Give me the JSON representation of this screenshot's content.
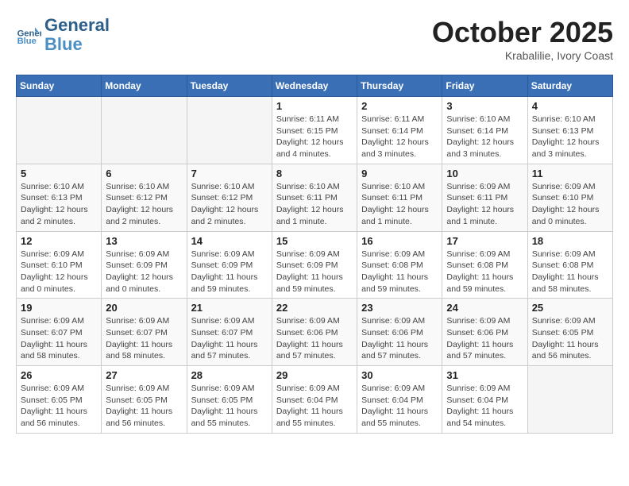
{
  "header": {
    "logo_line1": "General",
    "logo_line2": "Blue",
    "month": "October 2025",
    "location": "Krabalilie, Ivory Coast"
  },
  "weekdays": [
    "Sunday",
    "Monday",
    "Tuesday",
    "Wednesday",
    "Thursday",
    "Friday",
    "Saturday"
  ],
  "weeks": [
    [
      {
        "day": "",
        "info": ""
      },
      {
        "day": "",
        "info": ""
      },
      {
        "day": "",
        "info": ""
      },
      {
        "day": "1",
        "info": "Sunrise: 6:11 AM\nSunset: 6:15 PM\nDaylight: 12 hours\nand 4 minutes."
      },
      {
        "day": "2",
        "info": "Sunrise: 6:11 AM\nSunset: 6:14 PM\nDaylight: 12 hours\nand 3 minutes."
      },
      {
        "day": "3",
        "info": "Sunrise: 6:10 AM\nSunset: 6:14 PM\nDaylight: 12 hours\nand 3 minutes."
      },
      {
        "day": "4",
        "info": "Sunrise: 6:10 AM\nSunset: 6:13 PM\nDaylight: 12 hours\nand 3 minutes."
      }
    ],
    [
      {
        "day": "5",
        "info": "Sunrise: 6:10 AM\nSunset: 6:13 PM\nDaylight: 12 hours\nand 2 minutes."
      },
      {
        "day": "6",
        "info": "Sunrise: 6:10 AM\nSunset: 6:12 PM\nDaylight: 12 hours\nand 2 minutes."
      },
      {
        "day": "7",
        "info": "Sunrise: 6:10 AM\nSunset: 6:12 PM\nDaylight: 12 hours\nand 2 minutes."
      },
      {
        "day": "8",
        "info": "Sunrise: 6:10 AM\nSunset: 6:11 PM\nDaylight: 12 hours\nand 1 minute."
      },
      {
        "day": "9",
        "info": "Sunrise: 6:10 AM\nSunset: 6:11 PM\nDaylight: 12 hours\nand 1 minute."
      },
      {
        "day": "10",
        "info": "Sunrise: 6:09 AM\nSunset: 6:11 PM\nDaylight: 12 hours\nand 1 minute."
      },
      {
        "day": "11",
        "info": "Sunrise: 6:09 AM\nSunset: 6:10 PM\nDaylight: 12 hours\nand 0 minutes."
      }
    ],
    [
      {
        "day": "12",
        "info": "Sunrise: 6:09 AM\nSunset: 6:10 PM\nDaylight: 12 hours\nand 0 minutes."
      },
      {
        "day": "13",
        "info": "Sunrise: 6:09 AM\nSunset: 6:09 PM\nDaylight: 12 hours\nand 0 minutes."
      },
      {
        "day": "14",
        "info": "Sunrise: 6:09 AM\nSunset: 6:09 PM\nDaylight: 11 hours\nand 59 minutes."
      },
      {
        "day": "15",
        "info": "Sunrise: 6:09 AM\nSunset: 6:09 PM\nDaylight: 11 hours\nand 59 minutes."
      },
      {
        "day": "16",
        "info": "Sunrise: 6:09 AM\nSunset: 6:08 PM\nDaylight: 11 hours\nand 59 minutes."
      },
      {
        "day": "17",
        "info": "Sunrise: 6:09 AM\nSunset: 6:08 PM\nDaylight: 11 hours\nand 59 minutes."
      },
      {
        "day": "18",
        "info": "Sunrise: 6:09 AM\nSunset: 6:08 PM\nDaylight: 11 hours\nand 58 minutes."
      }
    ],
    [
      {
        "day": "19",
        "info": "Sunrise: 6:09 AM\nSunset: 6:07 PM\nDaylight: 11 hours\nand 58 minutes."
      },
      {
        "day": "20",
        "info": "Sunrise: 6:09 AM\nSunset: 6:07 PM\nDaylight: 11 hours\nand 58 minutes."
      },
      {
        "day": "21",
        "info": "Sunrise: 6:09 AM\nSunset: 6:07 PM\nDaylight: 11 hours\nand 57 minutes."
      },
      {
        "day": "22",
        "info": "Sunrise: 6:09 AM\nSunset: 6:06 PM\nDaylight: 11 hours\nand 57 minutes."
      },
      {
        "day": "23",
        "info": "Sunrise: 6:09 AM\nSunset: 6:06 PM\nDaylight: 11 hours\nand 57 minutes."
      },
      {
        "day": "24",
        "info": "Sunrise: 6:09 AM\nSunset: 6:06 PM\nDaylight: 11 hours\nand 57 minutes."
      },
      {
        "day": "25",
        "info": "Sunrise: 6:09 AM\nSunset: 6:05 PM\nDaylight: 11 hours\nand 56 minutes."
      }
    ],
    [
      {
        "day": "26",
        "info": "Sunrise: 6:09 AM\nSunset: 6:05 PM\nDaylight: 11 hours\nand 56 minutes."
      },
      {
        "day": "27",
        "info": "Sunrise: 6:09 AM\nSunset: 6:05 PM\nDaylight: 11 hours\nand 56 minutes."
      },
      {
        "day": "28",
        "info": "Sunrise: 6:09 AM\nSunset: 6:05 PM\nDaylight: 11 hours\nand 55 minutes."
      },
      {
        "day": "29",
        "info": "Sunrise: 6:09 AM\nSunset: 6:04 PM\nDaylight: 11 hours\nand 55 minutes."
      },
      {
        "day": "30",
        "info": "Sunrise: 6:09 AM\nSunset: 6:04 PM\nDaylight: 11 hours\nand 55 minutes."
      },
      {
        "day": "31",
        "info": "Sunrise: 6:09 AM\nSunset: 6:04 PM\nDaylight: 11 hours\nand 54 minutes."
      },
      {
        "day": "",
        "info": ""
      }
    ]
  ]
}
